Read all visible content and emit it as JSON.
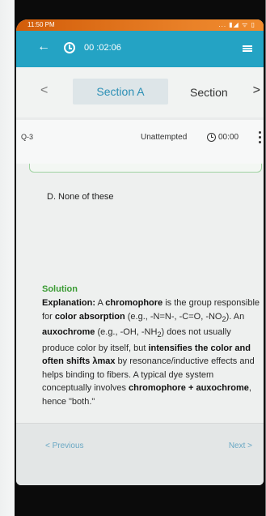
{
  "status_bar": {
    "time": "11:50 PM",
    "icons": "... ▮◢ ᯤ ▯"
  },
  "app_bar": {
    "timer": "00 :02:06",
    "back_icon": "←"
  },
  "sections": {
    "prev_chevron": "<",
    "active_tab": "Section A",
    "next_tab": "Section",
    "next_chevron": ">"
  },
  "question": {
    "number": "Q-3",
    "status": "Unattempted",
    "time": "00:00"
  },
  "option_d": "D. None of these",
  "solution": {
    "title": "Solution",
    "lead": "Explanation:",
    "t1": " A ",
    "b1": "chromophore",
    "t2": " is the group responsible for ",
    "b2": "color absorption",
    "t3": " (e.g., -N=N-, -C=O, -NO",
    "sub1": "2",
    "t4": "). An ",
    "b3": "auxochrome",
    "t5": " (e.g., -OH, -NH",
    "sub2": "2",
    "t6": ") does not usually produce color by itself, but ",
    "b4": "intensifies the color and often shifts λmax",
    "t7": " by resonance/inductive effects and helps binding to fibers. A typical dye system conceptually involves ",
    "b5": "chromophore + auxochrome",
    "t8": ", hence \"both.\""
  },
  "nav": {
    "previous": "< Previous",
    "next": "Next >"
  }
}
